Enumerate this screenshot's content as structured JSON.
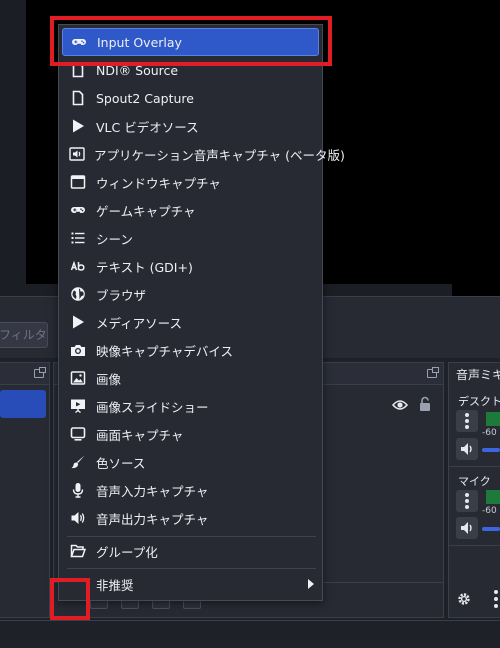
{
  "background": {
    "filter_button": "フィルタ",
    "audio_mixer_title": "音声ミキ",
    "audio_channels": [
      {
        "name": "デスクトッ",
        "db": "-60"
      },
      {
        "name": "マイク",
        "db": "-60"
      }
    ]
  },
  "menu": {
    "items": [
      {
        "label": "Input Overlay",
        "icon": "gamepad-icon",
        "active": true
      },
      {
        "label": "NDI® Source",
        "icon": "document-icon"
      },
      {
        "label": "Spout2 Capture",
        "icon": "document-icon"
      },
      {
        "label": "VLC ビデオソース",
        "icon": "play-icon"
      },
      {
        "label": "アプリケーション音声キャプチャ (ベータ版)",
        "icon": "app-audio-icon"
      },
      {
        "label": "ウィンドウキャプチャ",
        "icon": "window-icon"
      },
      {
        "label": "ゲームキャプチャ",
        "icon": "gamepad-icon"
      },
      {
        "label": "シーン",
        "icon": "list-icon"
      },
      {
        "label": "テキスト (GDI+)",
        "icon": "text-ab-icon"
      },
      {
        "label": "ブラウザ",
        "icon": "globe-icon"
      },
      {
        "label": "メディアソース",
        "icon": "play-icon"
      },
      {
        "label": "映像キャプチャデバイス",
        "icon": "camera-icon"
      },
      {
        "label": "画像",
        "icon": "image-icon"
      },
      {
        "label": "画像スライドショー",
        "icon": "slideshow-icon"
      },
      {
        "label": "画面キャプチャ",
        "icon": "monitor-icon"
      },
      {
        "label": "色ソース",
        "icon": "brush-icon"
      },
      {
        "label": "音声入力キャプチャ",
        "icon": "microphone-icon"
      },
      {
        "label": "音声出力キャプチャ",
        "icon": "speaker-icon"
      }
    ],
    "group": {
      "label": "グループ化",
      "icon": "folder-open-icon"
    },
    "deprecated": {
      "label": "非推奨",
      "icon": "chevron-right-icon"
    }
  },
  "colors": {
    "highlight": "#e01c24",
    "active_item": "#2f58c9",
    "menu_bg": "#272a33"
  }
}
